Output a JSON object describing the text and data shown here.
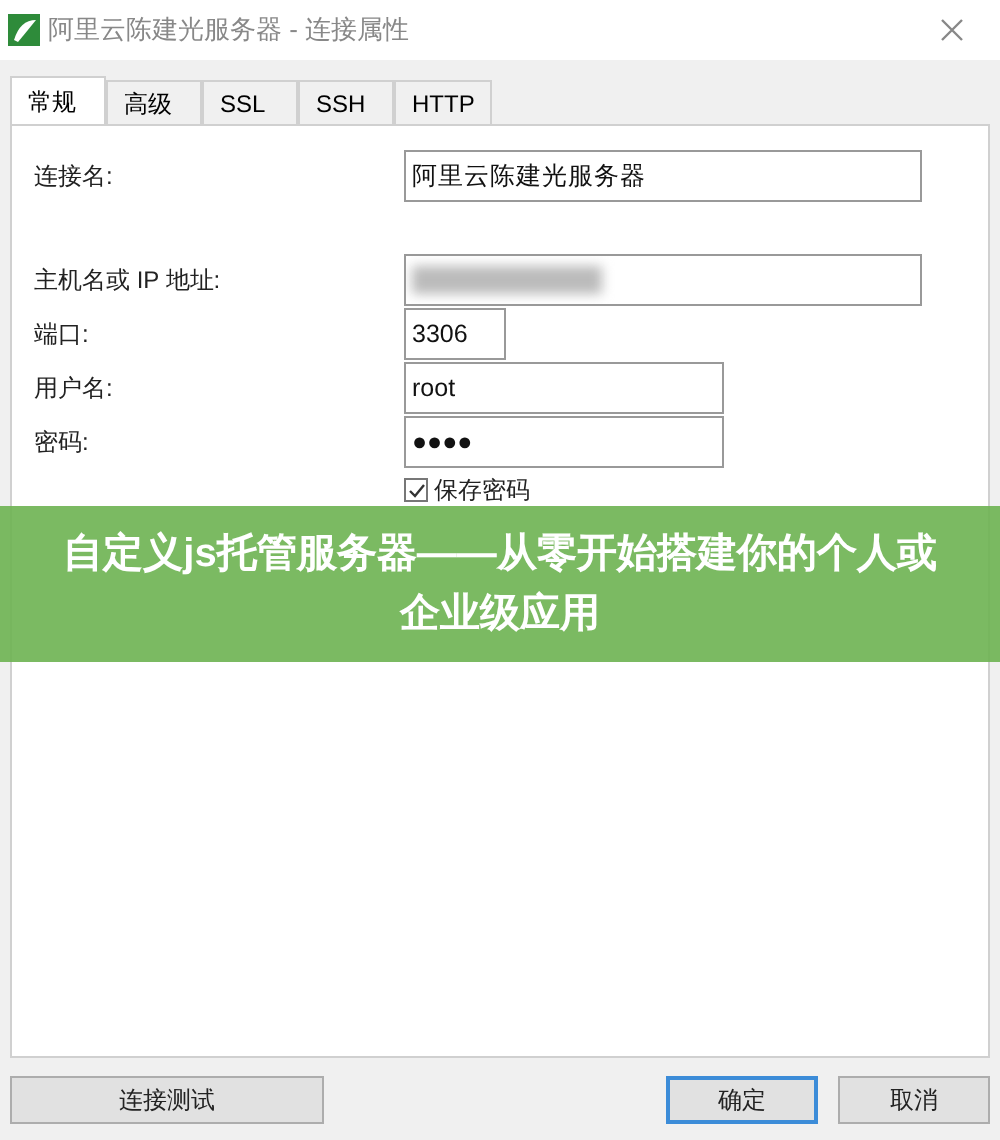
{
  "window": {
    "title": "阿里云陈建光服务器 - 连接属性"
  },
  "tabs": [
    {
      "label": "常规",
      "selected": true
    },
    {
      "label": "高级",
      "selected": false
    },
    {
      "label": "SSL",
      "selected": false
    },
    {
      "label": "SSH",
      "selected": false
    },
    {
      "label": "HTTP",
      "selected": false
    }
  ],
  "connection_name": {
    "label": "连接名:",
    "value": "阿里云陈建光服务器"
  },
  "host": {
    "label": "主机名或 IP 地址:"
  },
  "port": {
    "label": "端口:",
    "value": "3306"
  },
  "username": {
    "label": "用户名:",
    "value": "root"
  },
  "password": {
    "label": "密码:",
    "value": "●●●●"
  },
  "save_password": {
    "label": "保存密码",
    "checked": true
  },
  "banner": {
    "text": "自定义js托管服务器——从零开始搭建你的个人或企业级应用"
  },
  "buttons": [
    {
      "label": "连接测试",
      "default": false
    },
    {
      "label": "确定",
      "default": true
    },
    {
      "label": "取消",
      "default": false
    }
  ]
}
